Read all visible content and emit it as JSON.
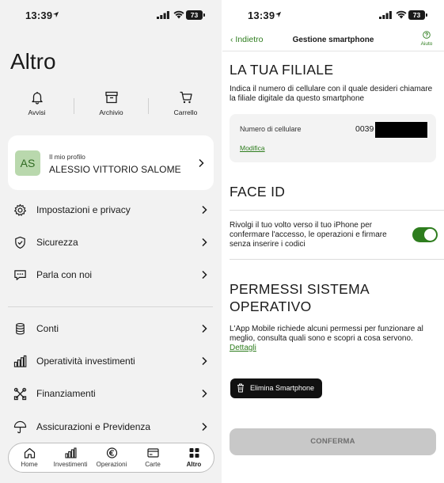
{
  "left_screen": {
    "status_bar": {
      "time": "13:39",
      "battery": "73"
    },
    "title": "Altro",
    "quick_actions": [
      {
        "label": "Avvisi",
        "icon": "bell-icon"
      },
      {
        "label": "Archivio",
        "icon": "archive-icon"
      },
      {
        "label": "Carrello",
        "icon": "cart-icon"
      }
    ],
    "profile": {
      "initials": "AS",
      "subtitle": "Il mio profilo",
      "name": "ALESSIO VITTORIO SALOME"
    },
    "menu_group_1": [
      {
        "label": "Impostazioni e privacy",
        "icon": "gear-icon"
      },
      {
        "label": "Sicurezza",
        "icon": "shield-icon"
      },
      {
        "label": "Parla con noi",
        "icon": "chat-icon"
      }
    ],
    "menu_group_2": [
      {
        "label": "Conti",
        "icon": "coins-stack-icon"
      },
      {
        "label": "Operatività investimenti",
        "icon": "bar-chart-icon"
      },
      {
        "label": "Finanziamenti",
        "icon": "tools-icon"
      },
      {
        "label": "Assicurazioni e Previdenza",
        "icon": "umbrella-icon"
      }
    ],
    "tab_bar": [
      {
        "label": "Home",
        "icon": "home-icon",
        "active": false
      },
      {
        "label": "Investimenti",
        "icon": "investments-icon",
        "active": false
      },
      {
        "label": "Operazioni",
        "icon": "euro-icon",
        "active": false
      },
      {
        "label": "Carte",
        "icon": "card-icon",
        "active": false
      },
      {
        "label": "Altro",
        "icon": "grid-icon",
        "active": true
      }
    ]
  },
  "right_screen": {
    "status_bar": {
      "time": "13:39",
      "battery": "73"
    },
    "nav": {
      "back_label": "Indietro",
      "title": "Gestione smartphone",
      "help_label": "Aiuto"
    },
    "branch": {
      "title": "LA TUA FILIALE",
      "text": "Indica il numero di cellulare con il quale desideri chiamare la filiale digitale da questo smartphone",
      "phone_label": "Numero di cellulare",
      "phone_prefix": "0039",
      "edit_label": "Modifica"
    },
    "face_id": {
      "title": "FACE ID",
      "text": "Rivolgi il tuo volto verso il tuo iPhone per confermare l'accesso, le operazioni e firmare senza inserire i codici",
      "enabled": true
    },
    "permissions": {
      "title": "PERMESSI SISTEMA OPERATIVO",
      "text": "L'App Mobile richiede alcuni permessi per funzionare al meglio, consulta quali sono e scopri a cosa servono.",
      "link_label": "Dettagli"
    },
    "delete_button": "Elimina Smartphone",
    "confirm_button": "CONFERMA",
    "accent_color": "#2e7d1e"
  }
}
